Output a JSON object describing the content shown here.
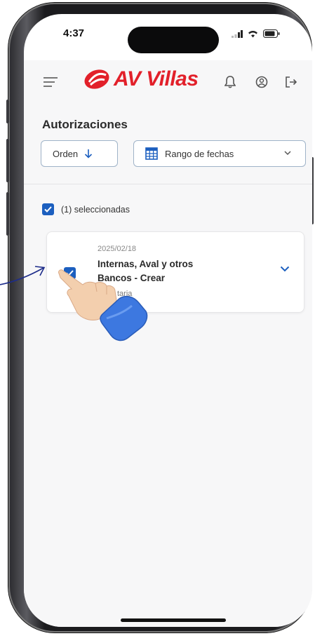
{
  "status_bar": {
    "time": "4:37"
  },
  "header": {
    "brand": "AV Villas",
    "brand_color": "#e2202a",
    "icons": [
      "menu-icon",
      "bell-icon",
      "account-icon",
      "logout-icon"
    ]
  },
  "page": {
    "title": "Autorizaciones",
    "order_button": "Orden",
    "date_range_button": "Rango de fechas",
    "selected_label": "(1) seleccionadas"
  },
  "cards": [
    {
      "date": "2025/02/18",
      "title_line1": "Internas, Aval y otros",
      "title_line2": "Bancos - Crear",
      "subtitle": "taria",
      "checked": true
    }
  ],
  "accent": "#1c5fbf"
}
